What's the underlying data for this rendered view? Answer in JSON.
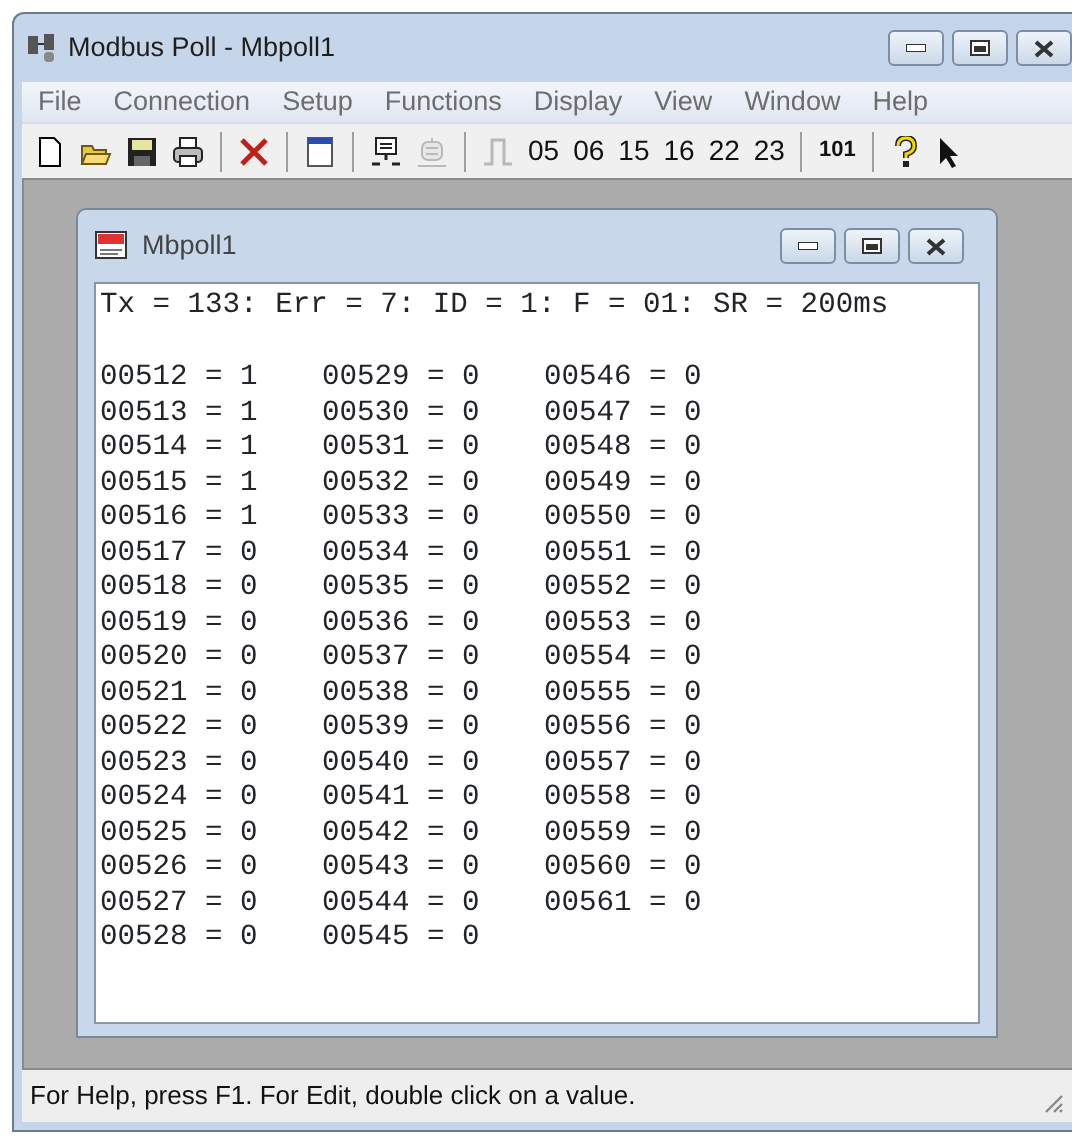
{
  "window": {
    "title": "Modbus Poll - Mbpoll1"
  },
  "menu": [
    "File",
    "Connection",
    "Setup",
    "Functions",
    "Display",
    "View",
    "Window",
    "Help"
  ],
  "toolbar": [
    {
      "kind": "new",
      "disabled": false
    },
    {
      "kind": "open",
      "disabled": false
    },
    {
      "kind": "save",
      "disabled": false
    },
    {
      "kind": "print",
      "disabled": false
    },
    {
      "kind": "sep"
    },
    {
      "kind": "delete",
      "disabled": false
    },
    {
      "kind": "sep"
    },
    {
      "kind": "window",
      "disabled": false
    },
    {
      "kind": "sep"
    },
    {
      "kind": "connect",
      "disabled": false
    },
    {
      "kind": "disconnect",
      "disabled": true
    },
    {
      "kind": "sep"
    },
    {
      "kind": "pulse",
      "disabled": true
    },
    {
      "kind": "text",
      "label": "05",
      "disabled": false
    },
    {
      "kind": "text",
      "label": "06",
      "disabled": false
    },
    {
      "kind": "text",
      "label": "15",
      "disabled": false
    },
    {
      "kind": "text",
      "label": "16",
      "disabled": false
    },
    {
      "kind": "text",
      "label": "22",
      "disabled": false
    },
    {
      "kind": "text",
      "label": "23",
      "disabled": false
    },
    {
      "kind": "sep"
    },
    {
      "kind": "small",
      "label": "101",
      "disabled": false
    },
    {
      "kind": "sep"
    },
    {
      "kind": "help",
      "disabled": false
    },
    {
      "kind": "pointer",
      "disabled": false
    }
  ],
  "child_window": {
    "title": "Mbpoll1",
    "summary": "Tx = 133: Err = 7: ID = 1: F = 01: SR = 200ms",
    "columns": [
      [
        "00512 = 1",
        "00513 = 1",
        "00514 = 1",
        "00515 = 1",
        "00516 = 1",
        "00517 = 0",
        "00518 = 0",
        "00519 = 0",
        "00520 = 0",
        "00521 = 0",
        "00522 = 0",
        "00523 = 0",
        "00524 = 0",
        "00525 = 0",
        "00526 = 0",
        "00527 = 0",
        "00528 = 0"
      ],
      [
        "00529 = 0",
        "00530 = 0",
        "00531 = 0",
        "00532 = 0",
        "00533 = 0",
        "00534 = 0",
        "00535 = 0",
        "00536 = 0",
        "00537 = 0",
        "00538 = 0",
        "00539 = 0",
        "00540 = 0",
        "00541 = 0",
        "00542 = 0",
        "00543 = 0",
        "00544 = 0",
        "00545 = 0"
      ],
      [
        "00546 = 0",
        "00547 = 0",
        "00548 = 0",
        "00549 = 0",
        "00550 = 0",
        "00551 = 0",
        "00552 = 0",
        "00553 = 0",
        "00554 = 0",
        "00555 = 0",
        "00556 = 0",
        "00557 = 0",
        "00558 = 0",
        "00559 = 0",
        "00560 = 0",
        "00561 = 0"
      ]
    ]
  },
  "status_bar": "For Help, press F1.  For Edit, double click on a value."
}
